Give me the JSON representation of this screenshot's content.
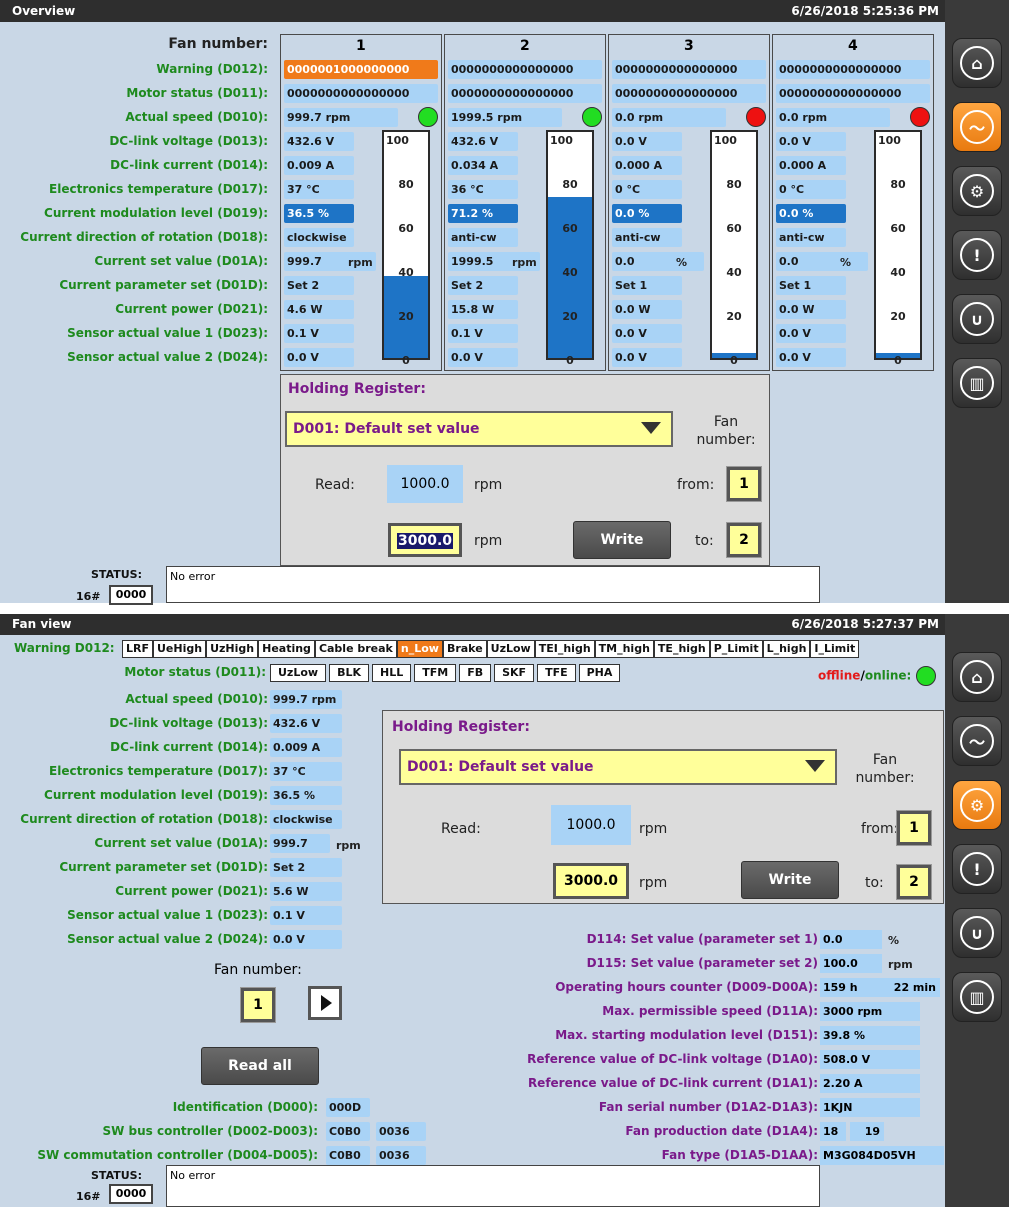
{
  "overview": {
    "title": "Overview",
    "datetime": "6/26/2018 5:25:36 PM",
    "labels": [
      "Fan number:",
      "Warning (D012):",
      "Motor status (D011):",
      "Actual speed (D010):",
      "DC-link voltage (D013):",
      "DC-link current (D014):",
      "Electronics temperature (D017):",
      "Current modulation level (D019):",
      "Current direction of rotation (D018):",
      "Current set value (D01A):",
      "Current parameter set (D01D):",
      "Current power (D021):",
      "Sensor actual value 1 (D023):",
      "Sensor actual value 2 (D024):"
    ],
    "fans": [
      {
        "num": "1",
        "warning": "0000001000000000",
        "motor": "0000000000000000",
        "speed": "999.7 rpm",
        "status_color": "#22dd22",
        "voltage": "432.6 V",
        "current": "0.009 A",
        "temp": "37 °C",
        "mod": "36.5 %",
        "dir": "clockwise",
        "setval": "999.7",
        "setunit": "rpm",
        "paramset": "Set 2",
        "power": "4.6 W",
        "s1": "0.1 V",
        "s2": "0.0 V",
        "gauge_pct": 36.5
      },
      {
        "num": "2",
        "warning": "0000000000000000",
        "motor": "0000000000000000",
        "speed": "1999.5 rpm",
        "status_color": "#22dd22",
        "voltage": "432.6 V",
        "current": "0.034 A",
        "temp": "36 °C",
        "mod": "71.2 %",
        "dir": "anti-cw",
        "setval": "1999.5",
        "setunit": "rpm",
        "paramset": "Set 2",
        "power": "15.8 W",
        "s1": "0.1 V",
        "s2": "0.0 V",
        "gauge_pct": 71.2
      },
      {
        "num": "3",
        "warning": "0000000000000000",
        "motor": "0000000000000000",
        "speed": "0.0 rpm",
        "status_color": "#ee1111",
        "voltage": "0.0 V",
        "current": "0.000 A",
        "temp": "0 °C",
        "mod": "0.0 %",
        "dir": "anti-cw",
        "setval": "0.0",
        "setunit": "%",
        "paramset": "Set 1",
        "power": "0.0 W",
        "s1": "0.0 V",
        "s2": "0.0 V",
        "gauge_pct": 2
      },
      {
        "num": "4",
        "warning": "0000000000000000",
        "motor": "0000000000000000",
        "speed": "0.0 rpm",
        "status_color": "#ee1111",
        "voltage": "0.0 V",
        "current": "0.000 A",
        "temp": "0 °C",
        "mod": "0.0 %",
        "dir": "anti-cw",
        "setval": "0.0",
        "setunit": "%",
        "paramset": "Set 1",
        "power": "0.0 W",
        "s1": "0.0 V",
        "s2": "0.0 V",
        "gauge_pct": 2
      }
    ],
    "gauge_ticks": [
      "100",
      "80",
      "60",
      "40",
      "20",
      "0"
    ],
    "hr": {
      "title": "Holding Register:",
      "select": "D001: Default set value",
      "fan_number_label": "Fan number:",
      "read_label": "Read:",
      "read_value": "1000.0",
      "read_unit": "rpm",
      "write_value": "3000.0",
      "write_unit": "rpm",
      "write_button": "Write",
      "from_label": "from:",
      "from_value": "1",
      "to_label": "to:",
      "to_value": "2"
    },
    "status": {
      "label": "STATUS:",
      "hex_label": "16#",
      "hex_value": "0000",
      "message": "No error"
    }
  },
  "fanview": {
    "title": "Fan view",
    "datetime": "6/26/2018 5:27:37 PM",
    "warning_label": "Warning D012:",
    "warning_flags": [
      "LRF",
      "UeHigh",
      "UzHigh",
      "Heating",
      "Cable break",
      "n_Low",
      "Brake",
      "UzLow",
      "TEI_high",
      "TM_high",
      "TE_high",
      "P_Limit",
      "L_high",
      "I_Limit"
    ],
    "warning_active": "n_Low",
    "motor_label": "Motor status (D011):",
    "motor_flags": [
      "UzLow",
      "BLK",
      "HLL",
      "TFM",
      "FB",
      "SKF",
      "TFE",
      "PHA"
    ],
    "offline_label": "offline",
    "online_label": "online:",
    "sep": "/",
    "rows": [
      {
        "label": "Actual speed (D010):",
        "value": "999.7 rpm"
      },
      {
        "label": "DC-link voltage (D013):",
        "value": "432.6 V"
      },
      {
        "label": "DC-link current (D014):",
        "value": "0.009 A"
      },
      {
        "label": "Electronics temperature (D017):",
        "value": "37 °C"
      },
      {
        "label": "Current modulation level (D019):",
        "value": "36.5 %"
      },
      {
        "label": "Current direction of rotation (D018):",
        "value": "clockwise"
      },
      {
        "label": "Current set value (D01A):",
        "value": "999.7",
        "unit": "rpm"
      },
      {
        "label": "Current parameter set (D01D):",
        "value": "Set 2"
      },
      {
        "label": "Current power (D021):",
        "value": "5.6 W"
      },
      {
        "label": "Sensor actual value 1 (D023):",
        "value": "0.1 V"
      },
      {
        "label": "Sensor actual value 2 (D024):",
        "value": "0.0 V"
      }
    ],
    "fan_number_label": "Fan number:",
    "fan_number": "1",
    "read_all": "Read all",
    "ident": [
      {
        "label": "Identification (D000):",
        "v1": "000D"
      },
      {
        "label": "SW bus controller (D002-D003):",
        "v1": "C0B0",
        "v2": "0036"
      },
      {
        "label": "SW commutation controller (D004-D005):",
        "v1": "C0B0",
        "v2": "0036"
      }
    ],
    "hr": {
      "title": "Holding Register:",
      "select": "D001: Default set value",
      "fan_number_label": "Fan number:",
      "read_label": "Read:",
      "read_value": "1000.0",
      "read_unit": "rpm",
      "write_value": "3000.0",
      "write_unit": "rpm",
      "write_button": "Write",
      "from_label": "from:",
      "from_value": "1",
      "to_label": "to:",
      "to_value": "2"
    },
    "params": [
      {
        "label": "D114: Set value (parameter set 1)",
        "value": "0.0",
        "unit": "%"
      },
      {
        "label": "D115: Set value (parameter set 2)",
        "value": "100.0",
        "unit": "rpm"
      },
      {
        "label": "Operating hours counter (D009-D00A):",
        "value": "159 h",
        "value2": "22 min"
      },
      {
        "label": "Max. permissible speed (D11A):",
        "value": "3000 rpm"
      },
      {
        "label": "Max. starting modulation level (D151):",
        "value": "39.8 %"
      },
      {
        "label": "Reference value of DC-link voltage (D1A0):",
        "value": "508.0 V"
      },
      {
        "label": "Reference value of DC-link current (D1A1):",
        "value": "2.20 A"
      },
      {
        "label": "Fan serial number (D1A2-D1A3):",
        "value": "1KJN"
      },
      {
        "label": "Fan production date (D1A4):",
        "value": "18",
        "value2": "19"
      },
      {
        "label": "Fan type (D1A5-D1AA):",
        "value": "M3G084D05VH"
      }
    ],
    "status": {
      "label": "STATUS:",
      "hex_label": "16#",
      "hex_value": "0000",
      "message": "No error"
    }
  },
  "sidebar1": [
    "home-icon",
    "chart-icon",
    "gear-icon",
    "warning-icon",
    "stethoscope-icon",
    "control-panel-icon"
  ],
  "sidebar2": [
    "home-icon",
    "chart-icon",
    "gear-icon",
    "warning-icon",
    "stethoscope-icon",
    "control-panel-icon"
  ],
  "colors": {
    "accent": "#f08b1c",
    "panel": "#c9d7e6",
    "value_bg": "#a9d3f6",
    "label_green": "#1e8a1e",
    "label_purple": "#7a1a8a"
  }
}
